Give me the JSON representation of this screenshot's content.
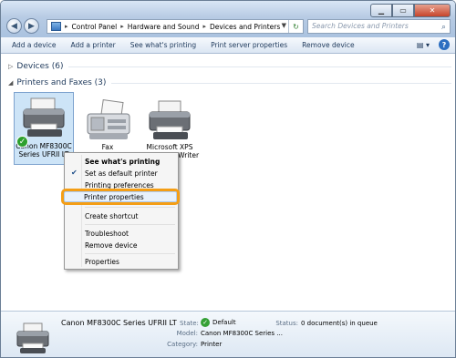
{
  "window_controls": {
    "min": "▁",
    "max": "▭",
    "close": "✕"
  },
  "nav": {
    "back": "◀",
    "forward": "▶"
  },
  "address": {
    "crumbs": [
      "Control Panel",
      "Hardware and Sound",
      "Devices and Printers"
    ],
    "sep": "▸"
  },
  "search": {
    "placeholder": "Search Devices and Printers"
  },
  "toolbar": {
    "items": [
      "Add a device",
      "Add a printer",
      "See what's printing",
      "Print server properties",
      "Remove device"
    ]
  },
  "groups": {
    "devices": "Devices (6)",
    "printers": "Printers and Faxes (3)"
  },
  "devices": [
    {
      "name_line1": "Canon MF8300C",
      "name_line2": "Series UFRII LT",
      "selected": true,
      "default": true
    },
    {
      "name_line1": "Fax",
      "name_line2": "",
      "selected": false
    },
    {
      "name_line1": "Microsoft XPS",
      "name_line2": "Document Writer",
      "selected": false
    }
  ],
  "context_menu": {
    "items": [
      {
        "label": "See what's printing",
        "bold": true
      },
      {
        "label": "Set as default printer",
        "checked": true
      },
      {
        "label": "Printing preferences"
      },
      {
        "label": "Printer properties",
        "highlighted": true
      },
      {
        "label": "Create shortcut"
      },
      {
        "label": "Troubleshoot"
      },
      {
        "label": "Remove device"
      },
      {
        "label": "Properties"
      }
    ]
  },
  "details": {
    "name": "Canon MF8300C Series UFRII LT",
    "state_label": "State:",
    "state_value": "Default",
    "model_label": "Model:",
    "model_value": "Canon MF8300C Series ...",
    "category_label": "Category:",
    "category_value": "Printer",
    "status_label": "Status:",
    "status_value": "0 document(s) in queue"
  },
  "colors": {
    "highlight": "#f49e16",
    "selection": "#cde4f7"
  }
}
